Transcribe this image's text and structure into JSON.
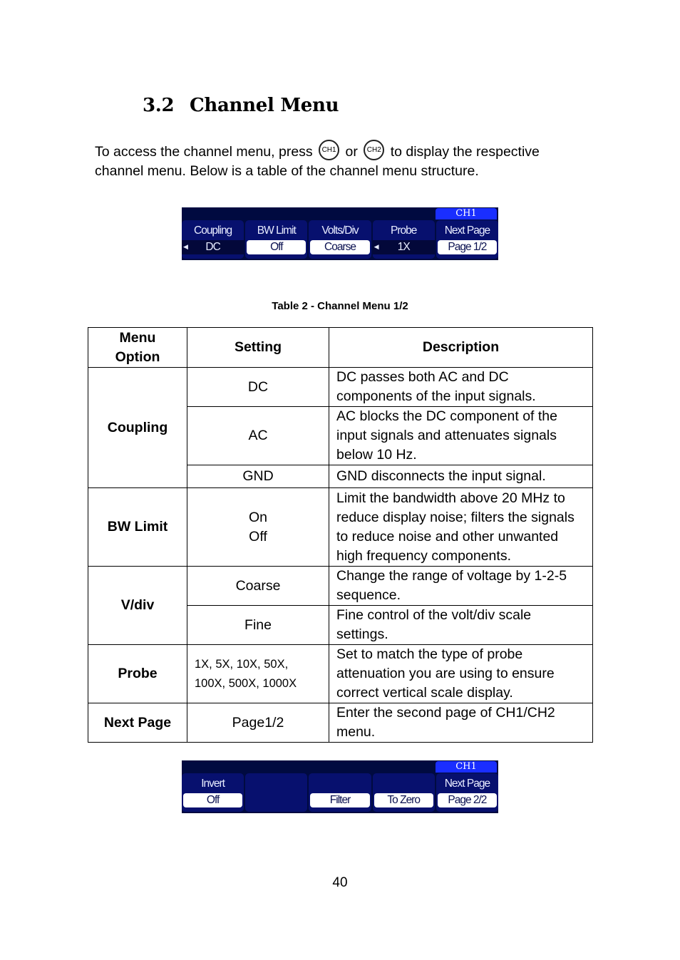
{
  "section": {
    "number": "3.2",
    "title": "Channel Menu"
  },
  "intro": {
    "part1": "To access the channel menu, press",
    "button1": "CH1",
    "or": "or",
    "button2": "CH2",
    "part2": "to display the respective",
    "line2": "channel menu.  Below is a table of the channel menu structure."
  },
  "menu_page1": {
    "channel": "CH1",
    "keys": [
      {
        "label": "Coupling",
        "value": "DC",
        "style": "plain",
        "arrow": true
      },
      {
        "label": "BW Limit",
        "value": "Off",
        "style": "boxed",
        "arrow": false
      },
      {
        "label": "Volts/Div",
        "value": "Coarse",
        "style": "boxed",
        "arrow": false
      },
      {
        "label": "Probe",
        "value": "1X",
        "style": "plain",
        "arrow": true
      },
      {
        "label": "Next Page",
        "value": "Page 1/2",
        "style": "boxed",
        "arrow": false
      }
    ]
  },
  "caption": "Table 2 - Channel Menu 1/2",
  "table": {
    "headers": [
      "Menu Option",
      "Setting",
      "Description"
    ],
    "rows": {
      "coupling": {
        "option": "Coupling",
        "settings": [
          {
            "setting": "DC",
            "description": "DC passes both AC and DC components of the input signals."
          },
          {
            "setting": "AC",
            "description": "AC blocks the DC component of the input signals and attenuates signals below 10 Hz."
          },
          {
            "setting": "GND",
            "description": "GND disconnects the input signal."
          }
        ]
      },
      "bw_limit": {
        "option": "BW Limit",
        "setting_on": "On",
        "setting_off": "Off",
        "description": "Limit the bandwidth above 20 MHz to reduce display noise; filters the signals to reduce noise and other unwanted high frequency components."
      },
      "vdiv": {
        "option": "V/div",
        "settings": [
          {
            "setting": "Coarse",
            "description": "Change the range of voltage by 1-2-5 sequence."
          },
          {
            "setting": "Fine",
            "description": "Fine control of the volt/div scale settings."
          }
        ]
      },
      "probe": {
        "option": "Probe",
        "setting_line1": "1X, 5X, 10X, 50X,",
        "setting_line2": "100X, 500X, 1000X",
        "description": "Set to match the type of probe attenuation you are using to ensure correct vertical scale display."
      },
      "next_page": {
        "option": "Next Page",
        "setting": "Page1/2",
        "description": "Enter the second page of CH1/CH2 menu."
      }
    }
  },
  "menu_page2": {
    "channel": "CH1",
    "keys": [
      {
        "label": "Invert",
        "value": "Off",
        "style": "boxed"
      },
      {
        "label": "",
        "value": "",
        "style": "none"
      },
      {
        "label": "",
        "value": "Filter",
        "style": "boxed"
      },
      {
        "label": "",
        "value": "To Zero",
        "style": "boxed"
      },
      {
        "label": "Next Page",
        "value": "Page 2/2",
        "style": "boxed"
      }
    ]
  },
  "page_number": "40",
  "colors": {
    "panel_bg": "#000a40",
    "key_bg": "#07106e",
    "channel_tag": "#1a2eff"
  }
}
